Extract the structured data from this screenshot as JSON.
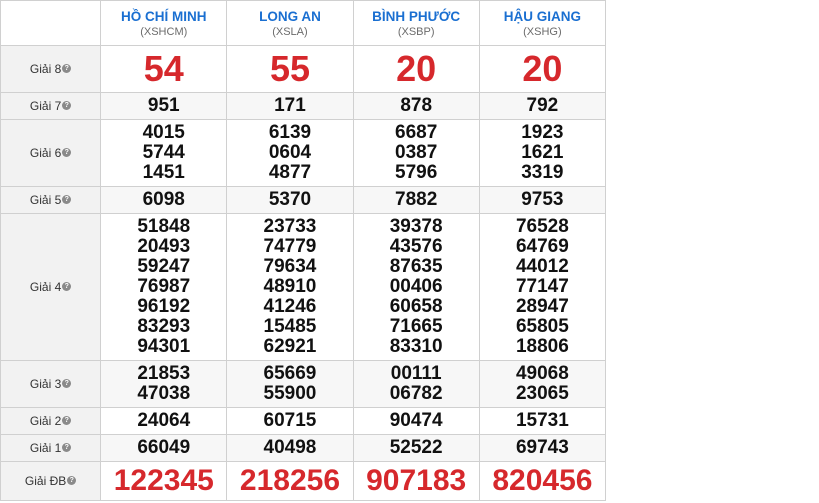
{
  "provinces": [
    {
      "name": "HỒ CHÍ MINH",
      "code": "(XSHCM)"
    },
    {
      "name": "LONG AN",
      "code": "(XSLA)"
    },
    {
      "name": "BÌNH PHƯỚC",
      "code": "(XSBP)"
    },
    {
      "name": "HẬU GIANG",
      "code": "(XSHG)"
    }
  ],
  "prizes": [
    {
      "label": "Giải 8",
      "cls": "g8",
      "values": [
        [
          "54"
        ],
        [
          "55"
        ],
        [
          "20"
        ],
        [
          "20"
        ]
      ]
    },
    {
      "label": "Giải 7",
      "cls": "g7",
      "values": [
        [
          "951"
        ],
        [
          "171"
        ],
        [
          "878"
        ],
        [
          "792"
        ]
      ]
    },
    {
      "label": "Giải 6",
      "cls": "g6",
      "values": [
        [
          "4015",
          "5744",
          "1451"
        ],
        [
          "6139",
          "0604",
          "4877"
        ],
        [
          "6687",
          "0387",
          "5796"
        ],
        [
          "1923",
          "1621",
          "3319"
        ]
      ]
    },
    {
      "label": "Giải 5",
      "cls": "g5",
      "values": [
        [
          "6098"
        ],
        [
          "5370"
        ],
        [
          "7882"
        ],
        [
          "9753"
        ]
      ]
    },
    {
      "label": "Giải 4",
      "cls": "g4",
      "values": [
        [
          "51848",
          "20493",
          "59247",
          "76987",
          "96192",
          "83293",
          "94301"
        ],
        [
          "23733",
          "74779",
          "79634",
          "48910",
          "41246",
          "15485",
          "62921"
        ],
        [
          "39378",
          "43576",
          "87635",
          "00406",
          "60658",
          "71665",
          "83310"
        ],
        [
          "76528",
          "64769",
          "44012",
          "77147",
          "28947",
          "65805",
          "18806"
        ]
      ]
    },
    {
      "label": "Giải 3",
      "cls": "g3",
      "values": [
        [
          "21853",
          "47038"
        ],
        [
          "65669",
          "55900"
        ],
        [
          "00111",
          "06782"
        ],
        [
          "49068",
          "23065"
        ]
      ]
    },
    {
      "label": "Giải 2",
      "cls": "g2",
      "values": [
        [
          "24064"
        ],
        [
          "60715"
        ],
        [
          "90474"
        ],
        [
          "15731"
        ]
      ]
    },
    {
      "label": "Giải 1",
      "cls": "g1",
      "values": [
        [
          "66049"
        ],
        [
          "40498"
        ],
        [
          "52522"
        ],
        [
          "69743"
        ]
      ]
    },
    {
      "label": "Giải ĐB",
      "cls": "gdb",
      "values": [
        [
          "122345"
        ],
        [
          "218256"
        ],
        [
          "907183"
        ],
        [
          "820456"
        ]
      ]
    }
  ],
  "icons": {
    "help": "question-circle-icon"
  },
  "colors": {
    "province_link": "#1a6fd1",
    "highlight_number": "#d6282c",
    "label_bg": "#f2f2f2"
  }
}
